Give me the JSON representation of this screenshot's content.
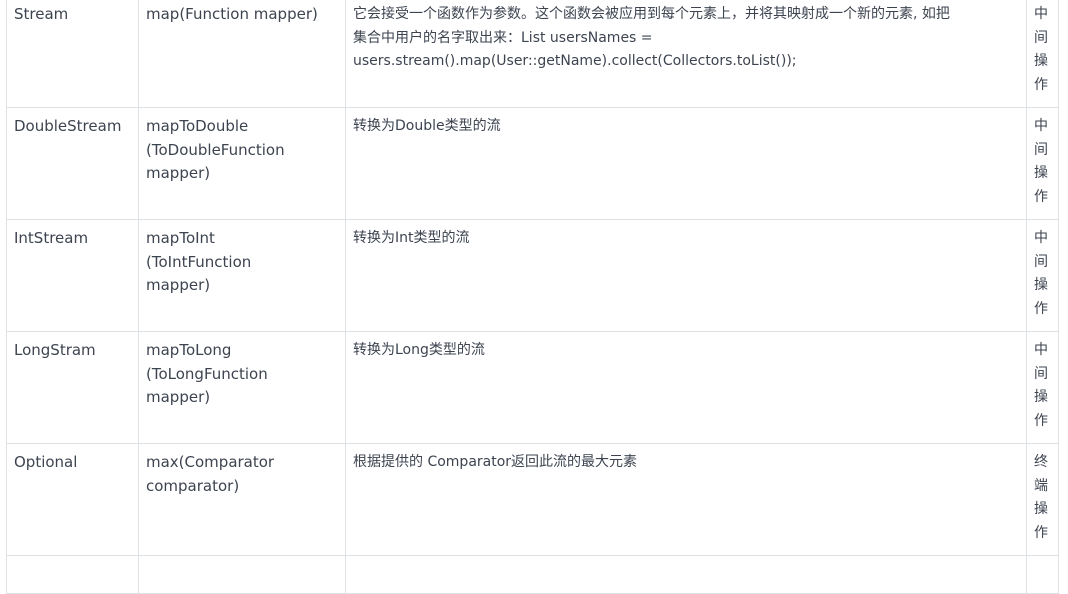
{
  "rows": [
    {
      "return_type": "Stream",
      "method_lines": [
        "map(Function mapper)"
      ],
      "desc_lines": [
        "它会接受一个函数作为参数。这个函数会被应用到每个元素上，并将其映射成一个新的元素, 如把",
        "集合中用户的名字取出来：List usersNames =",
        "users.stream().map(User::getName).collect(Collectors.toList());"
      ],
      "kind": [
        "中",
        "间",
        "操",
        "作"
      ]
    },
    {
      "return_type": "DoubleStream",
      "method_lines": [
        "mapToDouble",
        "(ToDoubleFunction",
        "mapper)"
      ],
      "desc_lines": [
        "转换为Double类型的流"
      ],
      "kind": [
        "中",
        "间",
        "操",
        "作"
      ]
    },
    {
      "return_type": "IntStream",
      "method_lines": [
        "mapToInt",
        "(ToIntFunction",
        "mapper)"
      ],
      "desc_lines": [
        "转换为Int类型的流"
      ],
      "kind": [
        "中",
        "间",
        "操",
        "作"
      ]
    },
    {
      "return_type": "LongStram",
      "method_lines": [
        "mapToLong",
        "(ToLongFunction",
        "mapper)"
      ],
      "desc_lines": [
        "转换为Long类型的流"
      ],
      "kind": [
        "中",
        "间",
        "操",
        "作"
      ]
    },
    {
      "return_type": "Optional",
      "method_lines": [
        "max(Comparator",
        "comparator)"
      ],
      "desc_lines": [
        "根据提供的 Comparator返回此流的最大元素"
      ],
      "kind": [
        "终",
        "端",
        "操",
        "作"
      ]
    }
  ]
}
